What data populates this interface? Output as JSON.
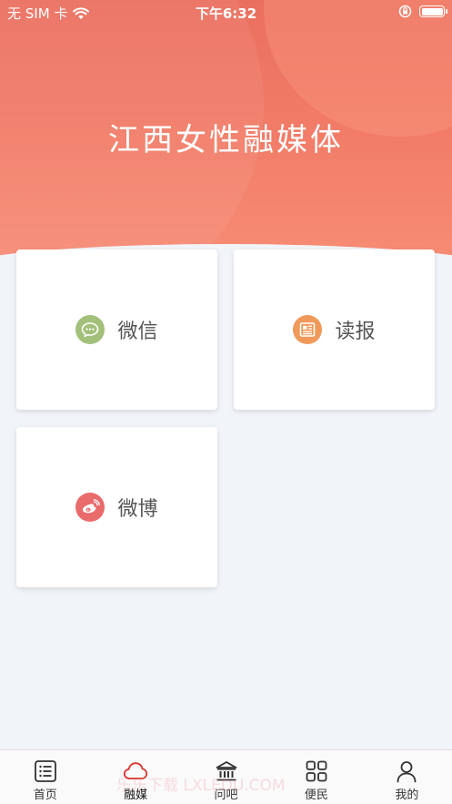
{
  "status_bar": {
    "carrier": "无 SIM 卡",
    "time": "下午6:32"
  },
  "header": {
    "title": "江西女性融媒体"
  },
  "cards": [
    {
      "label": "微信",
      "icon": "wechat-icon",
      "color": "#a3c07a"
    },
    {
      "label": "读报",
      "icon": "newspaper-icon",
      "color": "#f0995b"
    },
    {
      "label": "微博",
      "icon": "weibo-icon",
      "color": "#ea6b6b"
    }
  ],
  "tabbar": {
    "active_index": 1,
    "active_color": "#d9322c",
    "items": [
      {
        "label": "首页",
        "icon": "list-icon"
      },
      {
        "label": "融媒",
        "icon": "cloud-icon"
      },
      {
        "label": "问吧",
        "icon": "building-icon"
      },
      {
        "label": "便民",
        "icon": "grid-icon"
      },
      {
        "label": "我的",
        "icon": "person-icon"
      }
    ]
  },
  "watermark": "乐乐下载 LXLEDU.COM"
}
